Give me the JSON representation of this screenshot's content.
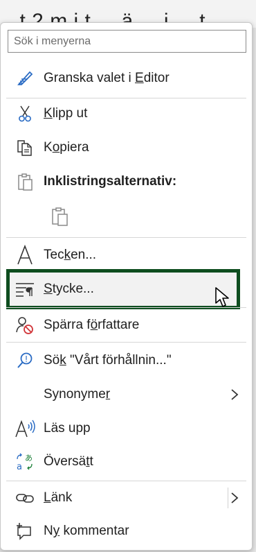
{
  "document": {
    "background_text": "...t 2 m i t ... ä ... i ... t ..."
  },
  "search": {
    "placeholder": "Sök i menyerna"
  },
  "items": {
    "editor": {
      "pre": "Granska valet i ",
      "u": "E",
      "post": "ditor",
      "icon": "editor-pen-icon"
    },
    "cut": {
      "pre": "",
      "u": "K",
      "post": "lipp ut",
      "icon": "scissors-icon"
    },
    "copy": {
      "pre": "K",
      "u": "o",
      "post": "piera",
      "icon": "copy-icon"
    },
    "paste_header": {
      "label": "Inklistringsalternativ:",
      "icon": "clipboard-icon"
    },
    "paste_option": {
      "icon": "paste-keep-text-icon"
    },
    "font": {
      "pre": "Tec",
      "u": "k",
      "post": "en...",
      "icon": "font-a-icon"
    },
    "paragraph": {
      "pre": "",
      "u": "S",
      "post": "tycke...",
      "icon": "paragraph-icon"
    },
    "block_authors": {
      "pre": "Spärra f",
      "u": "ö",
      "post": "rfattare",
      "icon": "block-user-icon"
    },
    "search_selection": {
      "pre": "Sö",
      "u": "k",
      "post": " \"Vårt förhållnin...\"",
      "icon": "search-icon"
    },
    "synonyms": {
      "pre": "Synonyme",
      "u": "r",
      "post": "",
      "icon": "chevron-right-icon"
    },
    "read_aloud": {
      "pre": "Läs upp",
      "u": "",
      "post": "",
      "icon": "read-aloud-icon"
    },
    "translate": {
      "pre": "Översä",
      "u": "t",
      "post": "t",
      "icon": "translate-icon"
    },
    "link": {
      "pre": "",
      "u": "L",
      "post": "änk",
      "icon": "link-icon"
    },
    "new_comment": {
      "pre": "N",
      "u": "y",
      "post": " kommentar",
      "icon": "new-comment-icon"
    }
  },
  "colors": {
    "highlight_border": "#0e4d1f",
    "accent_blue": "#2b6cc4",
    "block_red": "#d13438"
  }
}
